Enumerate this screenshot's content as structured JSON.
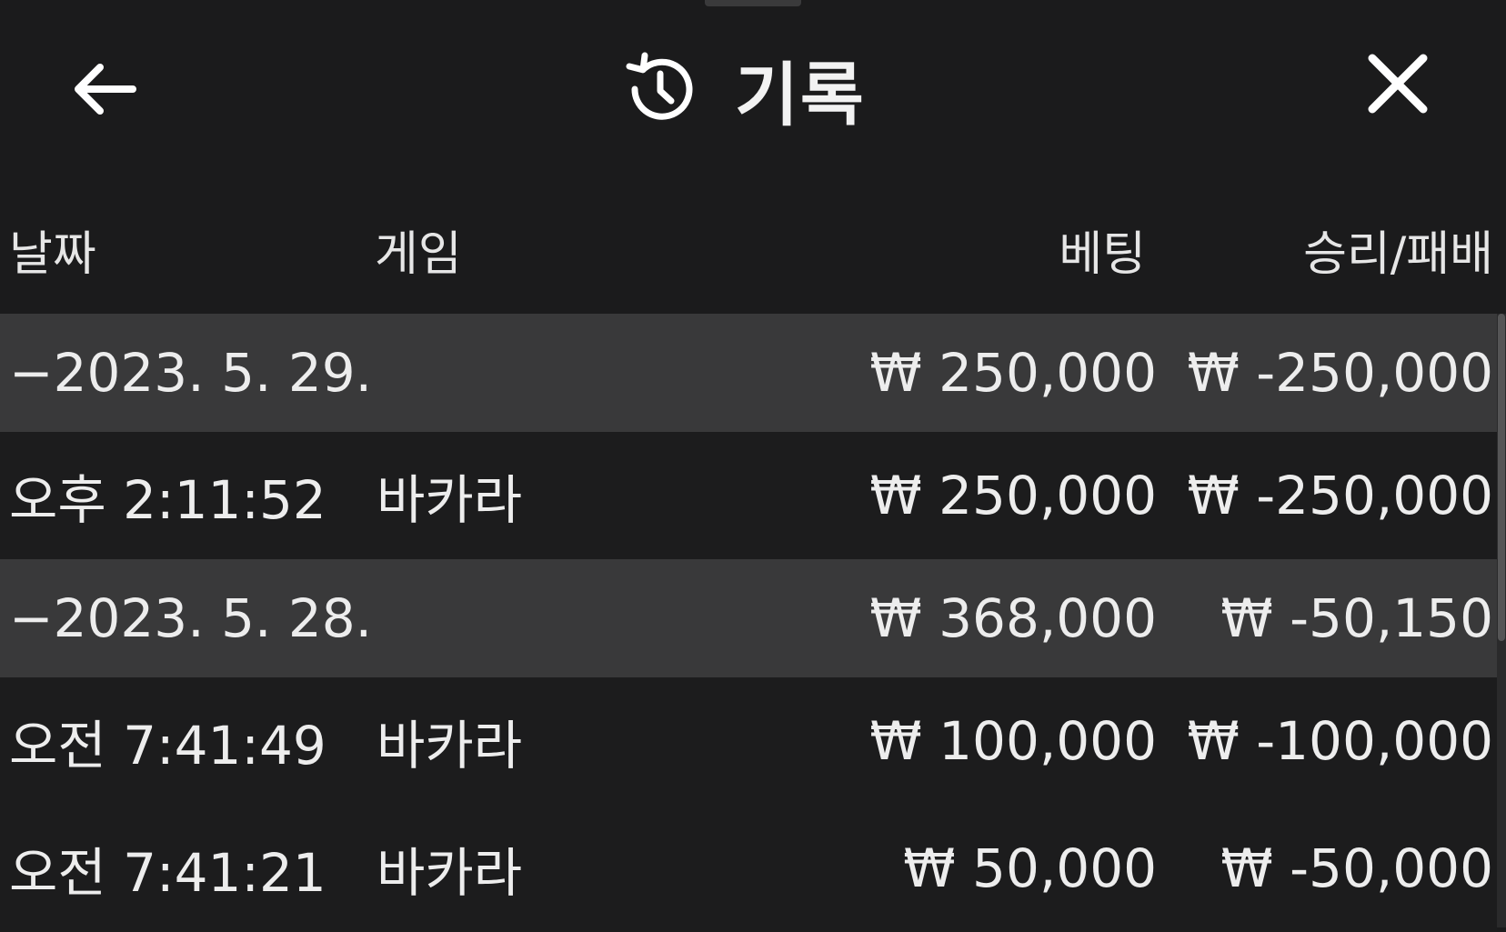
{
  "header": {
    "title": "기록",
    "back_icon": "arrow-left-icon",
    "history_icon": "history-icon",
    "close_icon": "close-icon"
  },
  "columns": {
    "date": "날짜",
    "game": "게임",
    "bet": "베팅",
    "result": "승리/패배"
  },
  "rows": [
    {
      "type": "group",
      "date": "−2023. 5. 29.",
      "game": "",
      "bet": "₩ 250,000",
      "result": "₩ -250,000"
    },
    {
      "type": "item",
      "date": "오후 2:11:52",
      "game": "바카라",
      "bet": "₩ 250,000",
      "result": "₩ -250,000"
    },
    {
      "type": "group",
      "date": "−2023. 5. 28.",
      "game": "",
      "bet": "₩ 368,000",
      "result": "₩ -50,150"
    },
    {
      "type": "item",
      "date": "오전 7:41:49",
      "game": "바카라",
      "bet": "₩ 100,000",
      "result": "₩ -100,000"
    },
    {
      "type": "item",
      "date": "오전 7:41:21",
      "game": "바카라",
      "bet": "₩ 50,000",
      "result": "₩ -50,000"
    }
  ],
  "colors": {
    "background": "#1b1b1c",
    "group_row": "#39393a",
    "text": "#ededed"
  }
}
